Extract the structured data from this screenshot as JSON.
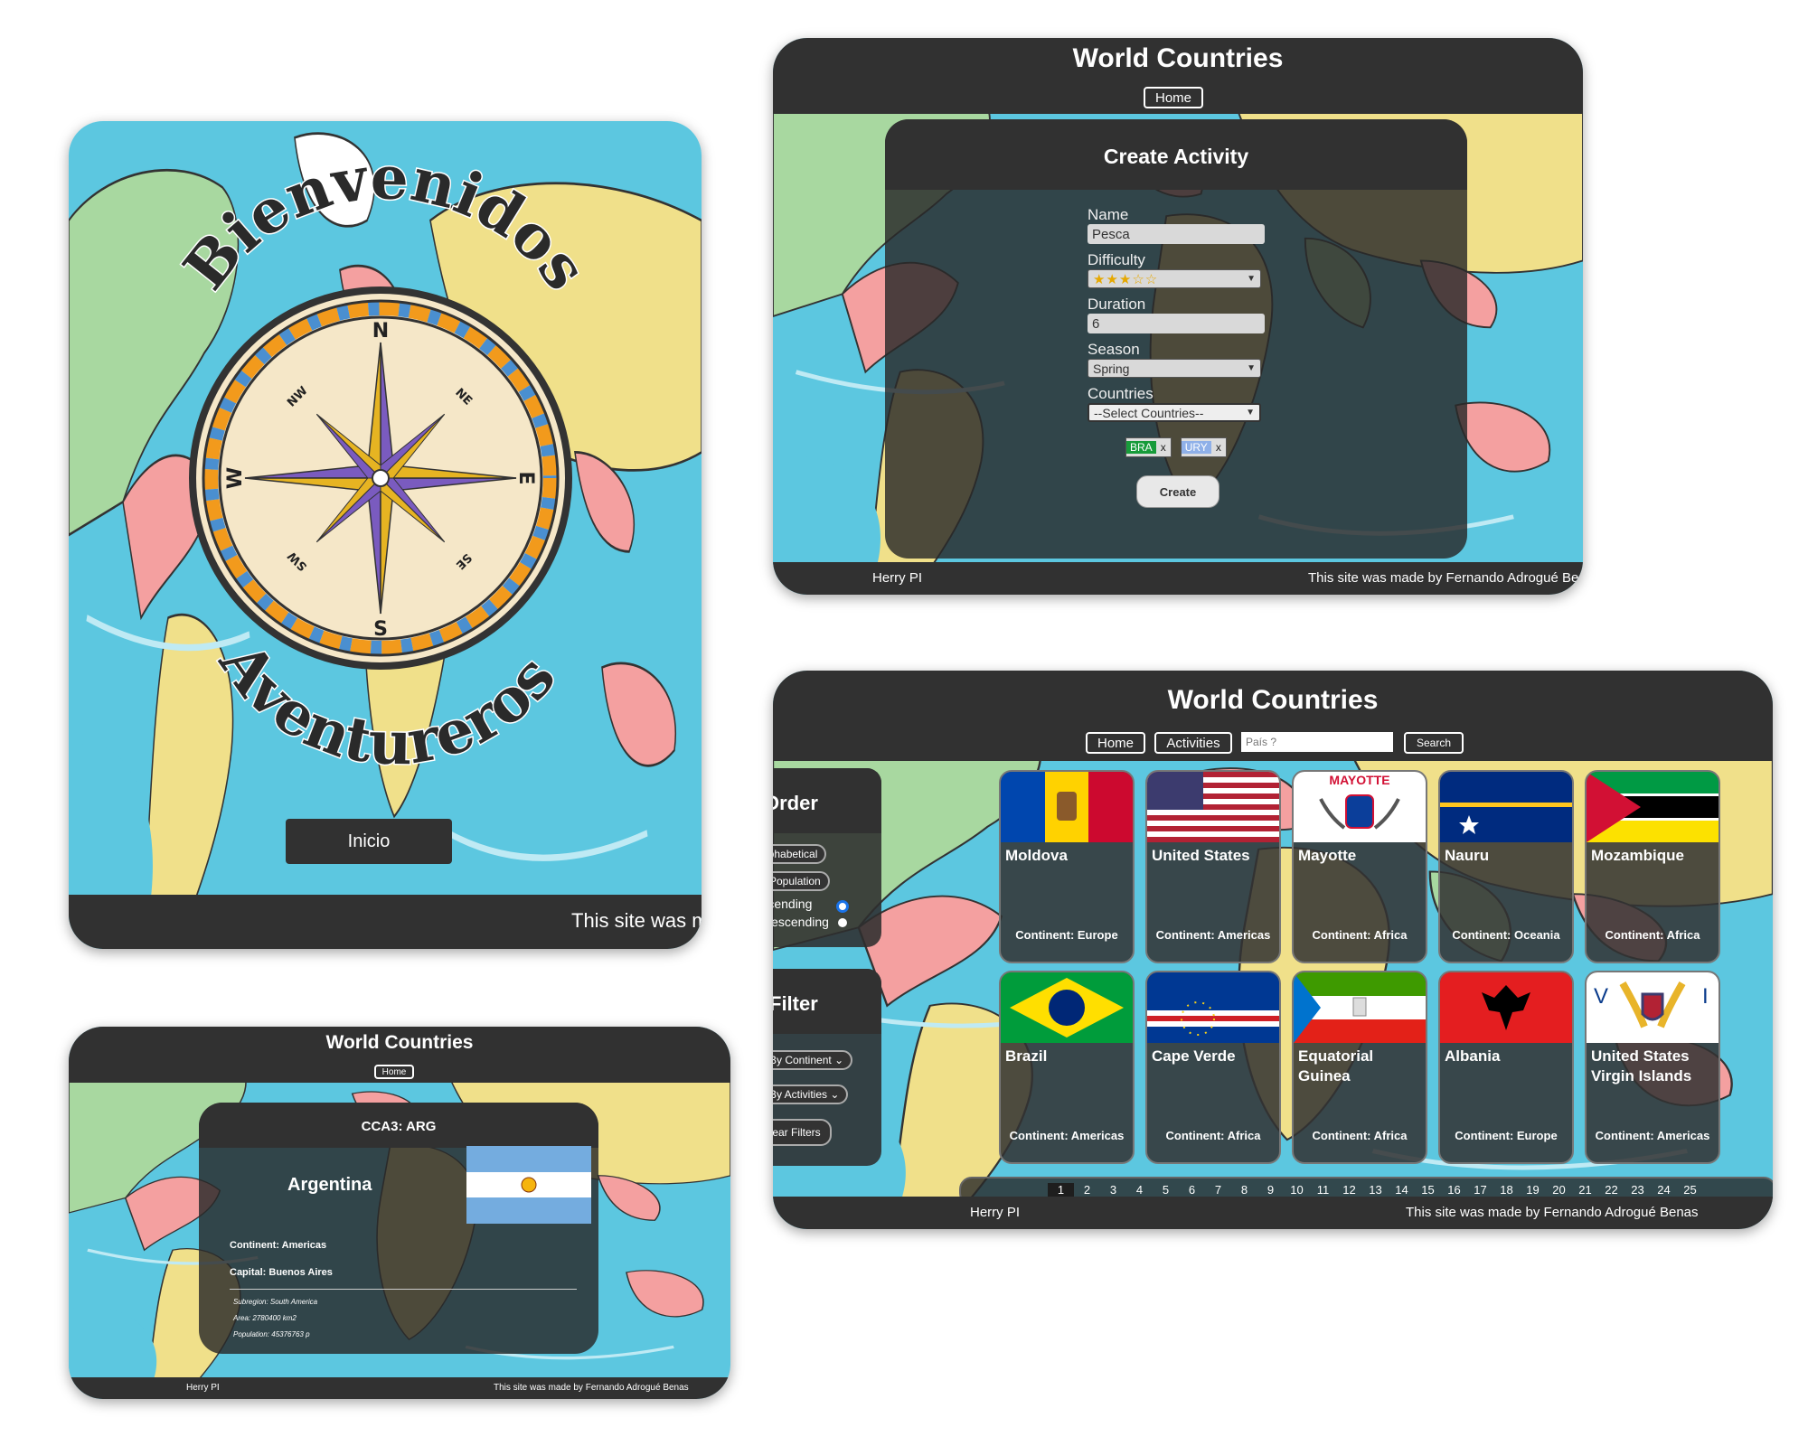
{
  "welcome": {
    "title_top": "Bienvenidos",
    "title_bottom": "Aventureros",
    "compass": {
      "n": "N",
      "s": "S",
      "e": "E",
      "w": "W",
      "ne": "NE",
      "nw": "NW",
      "se": "SE",
      "sw": "SW"
    },
    "button": "Inicio",
    "footer": "This site was m"
  },
  "create": {
    "header_title": "World Countries",
    "home_button": "Home",
    "panel_title": "Create Activity",
    "name_label": "Name",
    "name_value": "Pesca",
    "difficulty_label": "Difficulty",
    "difficulty_value": "★★★☆☆",
    "duration_label": "Duration",
    "duration_value": "6",
    "season_label": "Season",
    "season_value": "Spring",
    "countries_label": "Countries",
    "countries_value": "--Select Countries--",
    "chips": [
      {
        "code": "BRA",
        "remove": "x"
      },
      {
        "code": "URY",
        "remove": "x"
      }
    ],
    "create_button": "Create",
    "footer_left": "Herry PI",
    "footer_right": "This site was made by Fernando Adrogué Be"
  },
  "detail": {
    "header_title": "World Countries",
    "home_button": "Home",
    "cca3": "CCA3: ARG",
    "country": "Argentina",
    "continent": "Continent: Americas",
    "capital": "Capital: Buenos Aires",
    "subregion": "Subregion: South America",
    "area": "Area: 2780400 km2",
    "population": "Population: 45376763 p",
    "footer_left": "Herry PI",
    "footer_right": "This site was made by Fernando Adrogué Benas"
  },
  "home": {
    "header_title": "World Countries",
    "nav": {
      "home": "Home",
      "activities": "Activities",
      "search_placeholder": "País ?",
      "search_button": "Search"
    },
    "order": {
      "title": "Order",
      "alphabetical": "Alphabetical",
      "population": "Population",
      "ascending": "Ascending",
      "descending": "Descending"
    },
    "filter": {
      "title": "Filter",
      "by_continent": "By Continent",
      "by_activities": "By Activities",
      "clear": "Clear Filters"
    },
    "cards": [
      {
        "name": "Moldova",
        "continent": "Continent: Europe",
        "flag": "moldova"
      },
      {
        "name": "United States",
        "continent": "Continent: Americas",
        "flag": "usa"
      },
      {
        "name": "Mayotte",
        "continent": "Continent: Africa",
        "flag": "mayotte",
        "flag_text": "MAYOTTE"
      },
      {
        "name": "Nauru",
        "continent": "Continent: Oceania",
        "flag": "nauru"
      },
      {
        "name": "Mozambique",
        "continent": "Continent: Africa",
        "flag": "mozambique"
      },
      {
        "name": "Brazil",
        "continent": "Continent: Americas",
        "flag": "brazil"
      },
      {
        "name": "Cape Verde",
        "continent": "Continent: Africa",
        "flag": "capeverde"
      },
      {
        "name": "Equatorial Guinea",
        "continent": "Continent: Africa",
        "flag": "eqguinea"
      },
      {
        "name": "Albania",
        "continent": "Continent: Europe",
        "flag": "albania"
      },
      {
        "name": "United States Virgin Islands",
        "continent": "Continent: Americas",
        "flag": "usvi"
      }
    ],
    "pages": [
      "1",
      "2",
      "3",
      "4",
      "5",
      "6",
      "7",
      "8",
      "9",
      "10",
      "11",
      "12",
      "13",
      "14",
      "15",
      "16",
      "17",
      "18",
      "19",
      "20",
      "21",
      "22",
      "23",
      "24",
      "25"
    ],
    "current_page": "1",
    "footer_left": "Herry PI",
    "footer_right": "This site was made by Fernando Adrogué Benas"
  },
  "colors": {
    "bar": "#313131",
    "ocean": "#5cc7e0",
    "land_yellow": "#f0e08a",
    "land_green": "#a8d8a0",
    "land_pink": "#f4a0a0"
  }
}
